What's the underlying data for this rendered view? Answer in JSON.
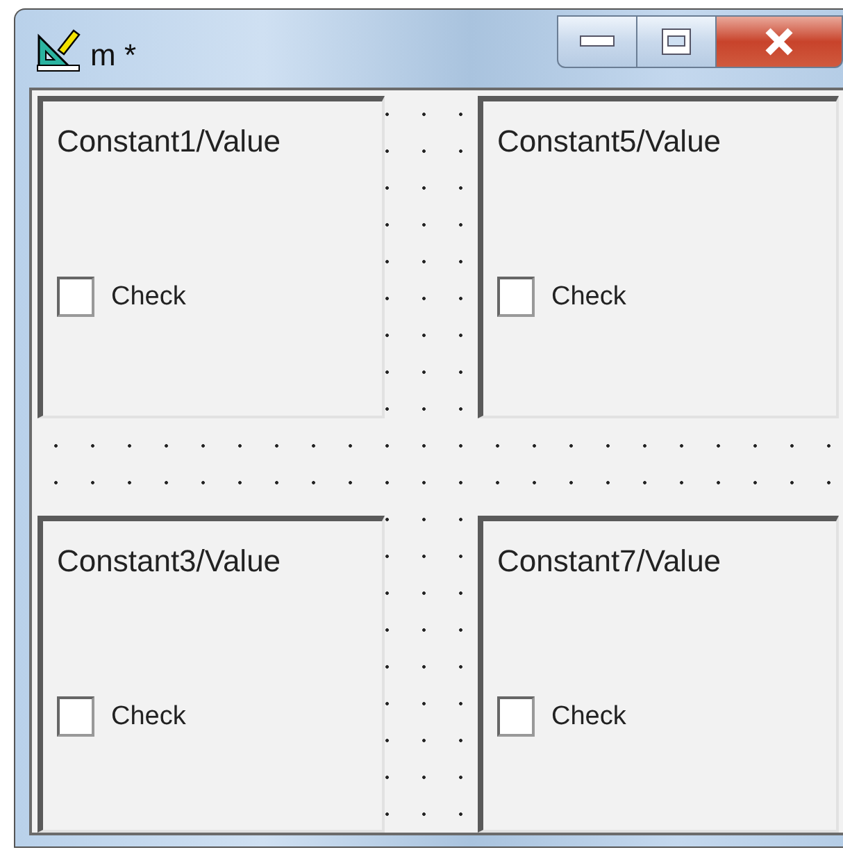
{
  "window": {
    "title": "m *"
  },
  "panels": [
    {
      "title": "Constant1/Value",
      "checkbox": {
        "label": "Check",
        "checked": false
      }
    },
    {
      "title": "Constant5/Value",
      "checkbox": {
        "label": "Check",
        "checked": false
      }
    },
    {
      "title": "Constant3/Value",
      "checkbox": {
        "label": "Check",
        "checked": false
      }
    },
    {
      "title": "Constant7/Value",
      "checkbox": {
        "label": "Check",
        "checked": false
      }
    }
  ]
}
